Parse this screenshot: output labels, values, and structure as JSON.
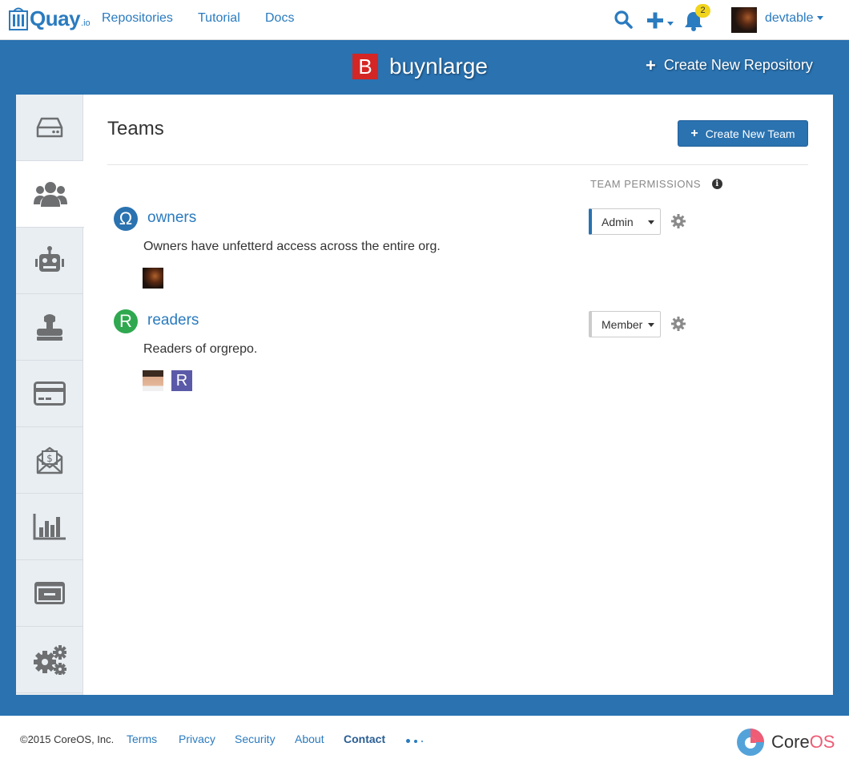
{
  "navbar": {
    "brand": "Quay",
    "brand_suffix": ".io",
    "links": [
      "Repositories",
      "Tutorial",
      "Docs"
    ],
    "notification_count": "2",
    "username": "devtable"
  },
  "org": {
    "avatar_letter": "B",
    "name": "buynlarge",
    "create_repo_label": "Create New Repository"
  },
  "sidebar": {
    "tabs": [
      "repositories",
      "teams",
      "robot-accounts",
      "default-permissions",
      "billing",
      "invoices",
      "usage-logs",
      "applications",
      "settings"
    ],
    "active": "teams"
  },
  "teams_page": {
    "title": "Teams",
    "create_team_label": "Create New Team",
    "permissions_header": "TEAM PERMISSIONS",
    "teams": [
      {
        "name": "owners",
        "avatar_letter": "Ω",
        "avatar_color": "#2a72b0",
        "description": "Owners have unfetterd access across the entire org.",
        "role": "Admin"
      },
      {
        "name": "readers",
        "avatar_letter": "R",
        "avatar_color": "#2fa84f",
        "description": "Readers of orgrepo.",
        "role": "Member",
        "robot_letter": "R"
      }
    ]
  },
  "footer": {
    "copyright": "©2015 CoreOS, Inc.",
    "links": [
      "Terms",
      "Privacy",
      "Security",
      "About"
    ],
    "contact": "Contact",
    "logo_core": "Core",
    "logo_os": "OS"
  },
  "colors": {
    "brand_blue": "#2a72b0",
    "link_blue": "#2a7bbf",
    "org_red": "#d42624",
    "badge_yellow": "#f1d41c"
  }
}
